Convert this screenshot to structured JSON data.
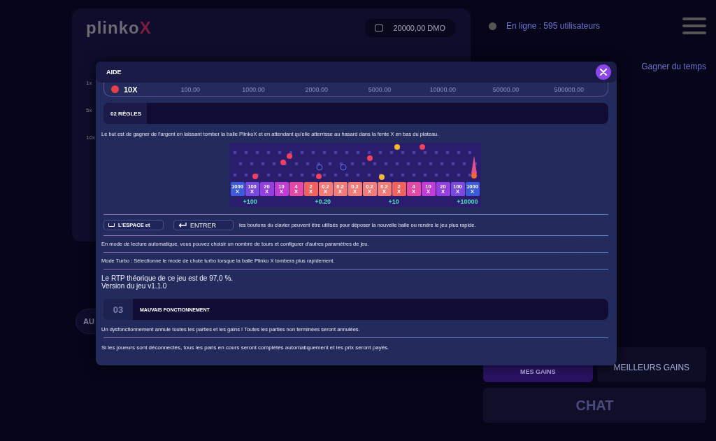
{
  "header": {
    "logo": "plinko",
    "logo_mark": "X",
    "balance": "20000,00 DMO",
    "online": "En ligne : 595 utilisateurs"
  },
  "side_multipliers": [
    "1x",
    "5x",
    "10x"
  ],
  "auto_button": "AU",
  "save_time": "Gagner du temps",
  "tabs": [
    {
      "label": "MES GAINS",
      "selected": true
    },
    {
      "label": "MEILLEURS GAINS",
      "selected": false
    }
  ],
  "chat_button": "CHAT",
  "modal": {
    "title": "AIDE",
    "payout_row": {
      "label": "10X",
      "values": [
        "100.00",
        "1000.00",
        "2000.00",
        "5000.00",
        "10000.00",
        "50000.00",
        "500000.00"
      ]
    },
    "rules_section": {
      "title": "02 RÈGLES"
    },
    "rules_text": "Le but est de gagner de l'argent en laissant tomber la balle PlinkoX et en attendant qu'elle atterrisse au hasard dans la fente X en bas du plateau.",
    "board": {
      "slots": [
        {
          "value": "1000",
          "unit": "X",
          "color": "#3b5bd9"
        },
        {
          "value": "100",
          "unit": "X",
          "color": "#7a4ae0"
        },
        {
          "value": "20",
          "unit": "X",
          "color": "#9440e0"
        },
        {
          "value": "10",
          "unit": "X",
          "color": "#c23cd6"
        },
        {
          "value": "4",
          "unit": "X",
          "color": "#e24aa6"
        },
        {
          "value": "2",
          "unit": "X",
          "color": "#f0625e"
        },
        {
          "value": "0.2",
          "unit": "X",
          "color": "#f27c78"
        },
        {
          "value": "0.2",
          "unit": "X",
          "color": "#f27c78"
        },
        {
          "value": "0.2",
          "unit": "X",
          "color": "#f27c78"
        },
        {
          "value": "0.2",
          "unit": "X",
          "color": "#f27c78"
        },
        {
          "value": "0.2",
          "unit": "X",
          "color": "#f27c78"
        },
        {
          "value": "2",
          "unit": "X",
          "color": "#f0625e"
        },
        {
          "value": "4",
          "unit": "X",
          "color": "#e24aa6"
        },
        {
          "value": "10",
          "unit": "X",
          "color": "#c23cd6"
        },
        {
          "value": "20",
          "unit": "X",
          "color": "#9440e0"
        },
        {
          "value": "100",
          "unit": "X",
          "color": "#7a4ae0"
        },
        {
          "value": "1000",
          "unit": "X",
          "color": "#3b5bd9"
        }
      ],
      "gains": [
        "+100",
        "+0.20",
        "+10",
        "+10000"
      ]
    },
    "keys": {
      "space": "L'ESPACE et",
      "enter": "ENTRER",
      "text": "les boutons du clavier peuvent être utilisés pour déposer la nouvelle balle ou rendre le jeu plus rapide."
    },
    "autoplay_text": "En mode de lecture automatique, vous pouvez choisir un nombre de tours et configurer d'autres paramètres de jeu.",
    "turbo_text": "Mode Turbo : Sélectionne le mode de chute turbo lorsque la balle Plinko X tombera plus rapidement.",
    "rtp_text": "Le RTP théorique de ce jeu est de 97,0 %.",
    "version_text": "Version du jeu v1.1.0",
    "malfunction_section": {
      "number": "03",
      "title": "MAUVAIS FONCTIONNEMENT"
    },
    "malfunction_text": "Un dysfonctionnement annule toutes les parties et les gains ! Toutes les parties non terminées seront annulées.",
    "disconnect_text": "Si les joueurs sont déconnectés, tous les paris en cours seront complétés automatiquement et les prix seront payés."
  }
}
